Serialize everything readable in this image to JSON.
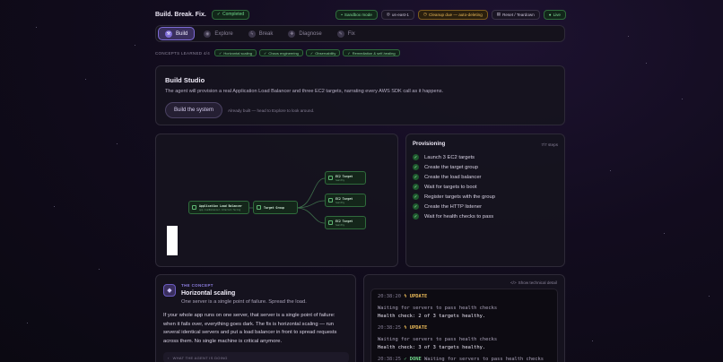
{
  "header": {
    "brand": "Build. Break. Fix.",
    "status_badge": "Completed",
    "chips": [
      {
        "label": "Sandbox mode",
        "icon": "dot-icon"
      },
      {
        "label": "us-east-1",
        "icon": "globe-icon"
      },
      {
        "label": "Cleanup due — auto-deleting",
        "icon": "clock-icon"
      },
      {
        "label": "Reset / Teardown",
        "icon": "trash-icon"
      },
      {
        "label": "Live",
        "icon": "dot-icon"
      }
    ]
  },
  "nav": {
    "tabs": [
      {
        "label": "Build",
        "active": true,
        "icon": "hammer-icon"
      },
      {
        "label": "Explore",
        "active": false,
        "icon": "compass-icon"
      },
      {
        "label": "Break",
        "active": false,
        "icon": "bolt-icon"
      },
      {
        "label": "Diagnose",
        "active": false,
        "icon": "stethoscope-icon"
      },
      {
        "label": "Fix",
        "active": false,
        "icon": "wrench-icon"
      }
    ]
  },
  "concepts": {
    "label": "CONCEPTS LEARNED 4/4",
    "items": [
      "Horizontal scaling",
      "Chaos engineering",
      "Observability",
      "Remediation & self-healing"
    ]
  },
  "studio": {
    "title": "Build Studio",
    "description": "The agent will provision a real Application Load Balancer and three EC2 targets, narrating every AWS SDK call as it happens.",
    "button": "Build the system",
    "hint": "Already built — head to Explore to look around."
  },
  "diagram": {
    "alb": {
      "title": "Application Load Balancer",
      "sub": "app-loadbalancer-internet-facing"
    },
    "tg": {
      "title": "Target Group",
      "sub": ""
    },
    "targets": [
      {
        "title": "EC2 Target",
        "sub": "healthy"
      },
      {
        "title": "EC2 Target",
        "sub": "healthy"
      },
      {
        "title": "EC2 Target",
        "sub": "healthy"
      }
    ]
  },
  "provisioning": {
    "title": "Provisioning",
    "count": "7/7 steps",
    "steps": [
      "Launch 3 EC2 targets",
      "Create the target group",
      "Create the load balancer",
      "Wait for targets to boot",
      "Register targets with the group",
      "Create the HTTP listener",
      "Wait for health checks to pass"
    ]
  },
  "concept_card": {
    "eyebrow": "THE CONCEPT",
    "title": "Horizontal scaling",
    "subtitle": "One server is a single point of failure. Spread the load.",
    "body": "If your whole app runs on one server, that server is a single point of failure: when it fails over, everything goes dark. The fix is horizontal scaling — run several identical servers and put a load balancer in front to spread requests across them. No single machine is critical anymore.",
    "footer": "WHAT THE AGENT IS DOING"
  },
  "log": {
    "toggle": "Show technical detail",
    "entries": [
      {
        "time": "20:38:20",
        "tag": "UPDATE",
        "kind": "upd",
        "msg": "Waiting for servers to pass health checks",
        "result": "Health check: 2 of 3 targets healthy."
      },
      {
        "time": "20:38:25",
        "tag": "UPDATE",
        "kind": "upd",
        "msg": "Waiting for servers to pass health checks",
        "result": "Health check: 3 of 3 targets healthy."
      },
      {
        "time": "20:38:25",
        "tag": "DONE",
        "kind": "done",
        "msg": "Waiting for servers to pass health checks",
        "result": ""
      }
    ]
  }
}
